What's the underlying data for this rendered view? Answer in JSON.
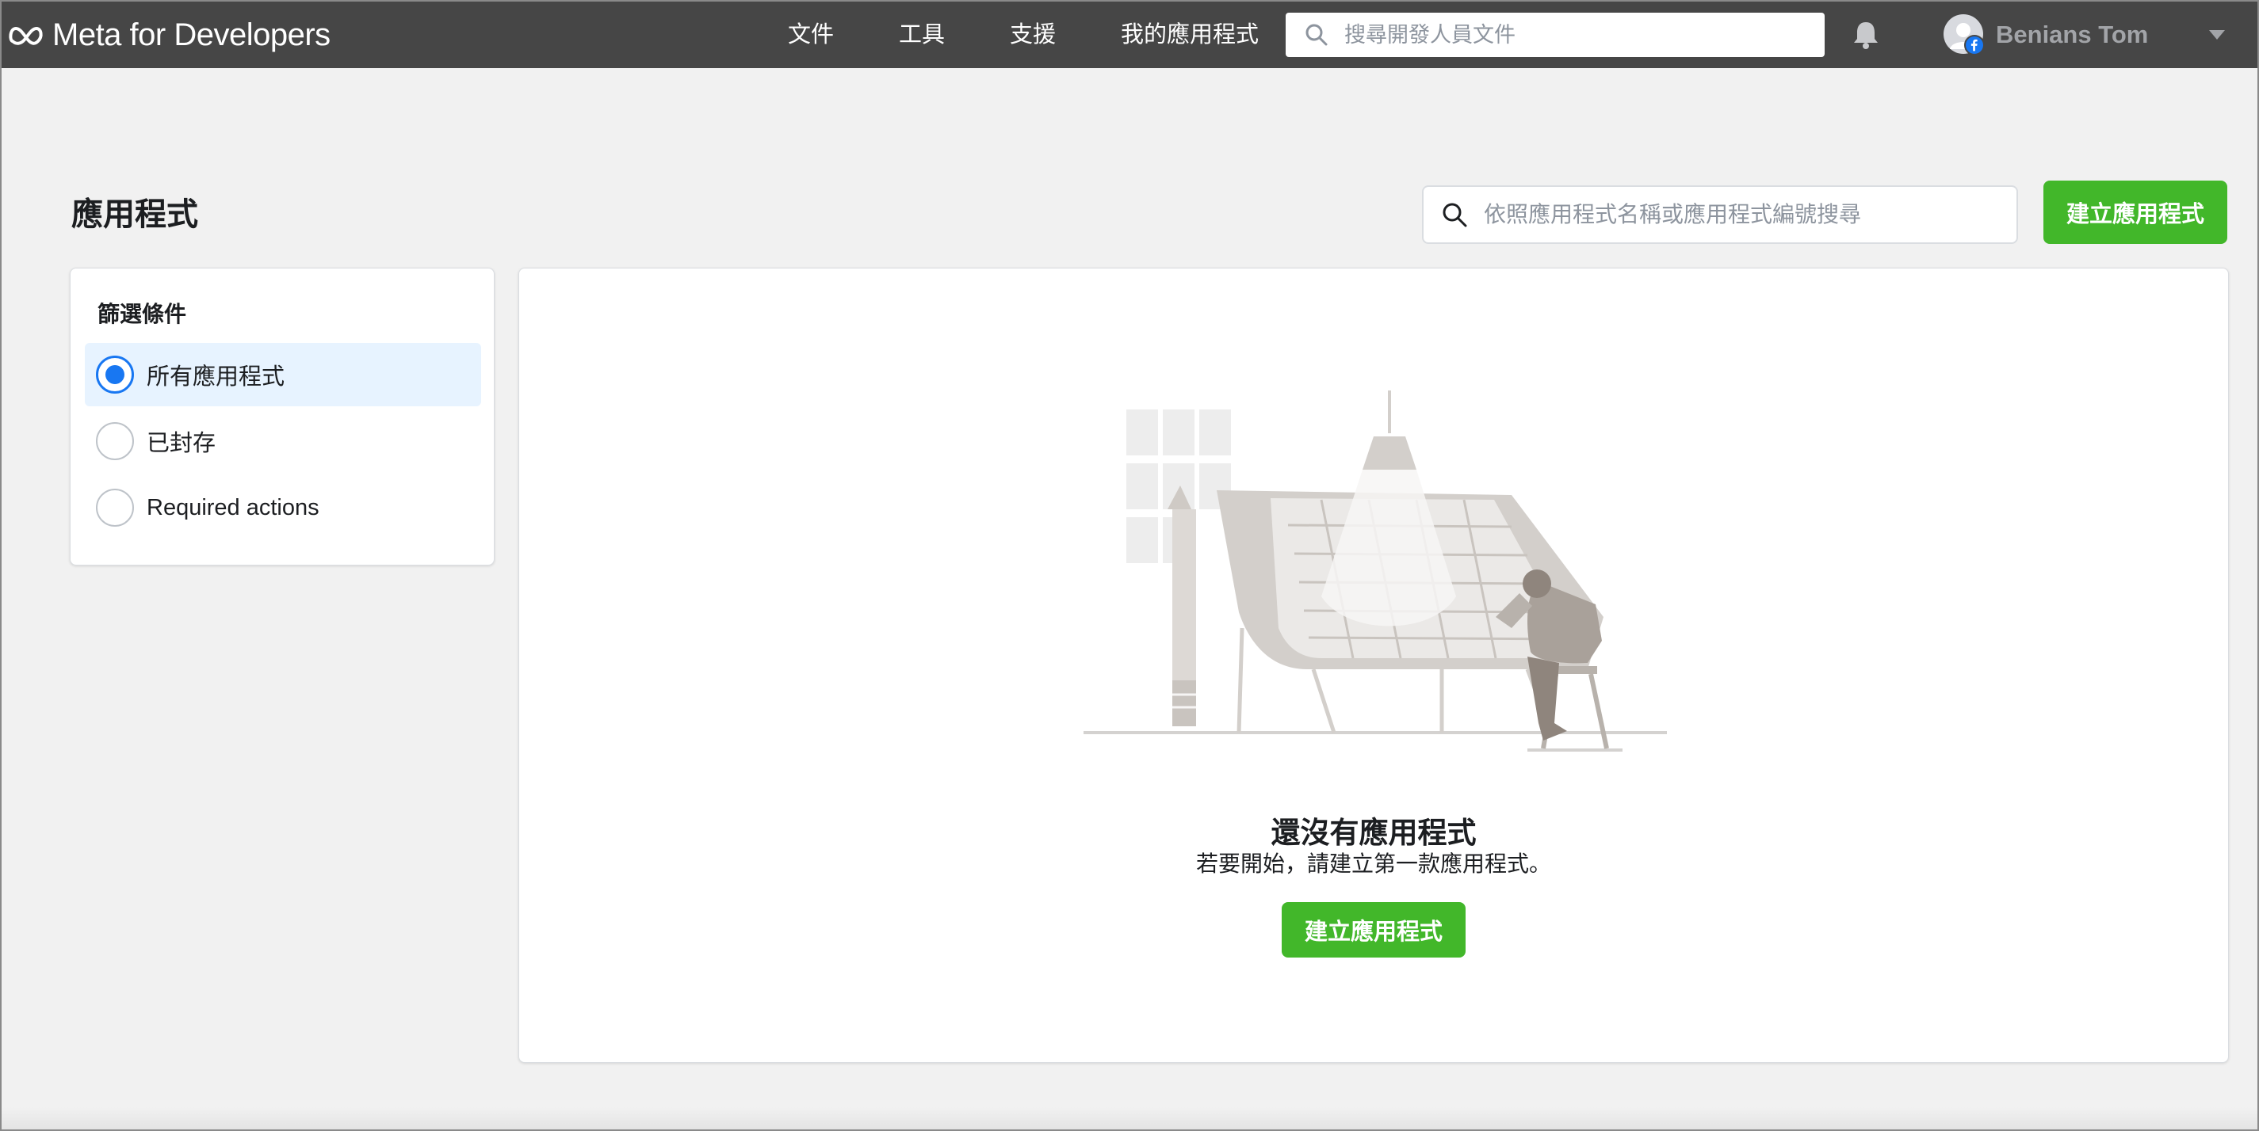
{
  "brand": {
    "name": "Meta for Developers"
  },
  "nav": {
    "docs": "文件",
    "tools": "工具",
    "support": "支援",
    "my_apps": "我的應用程式"
  },
  "top_search": {
    "placeholder": "搜尋開發人員文件"
  },
  "user": {
    "name": "Benians Tom"
  },
  "page": {
    "title": "應用程式",
    "search_placeholder": "依照應用程式名稱或應用程式編號搜尋",
    "create_button": "建立應用程式"
  },
  "filters": {
    "title": "篩選條件",
    "options": [
      {
        "label": "所有應用程式",
        "selected": true
      },
      {
        "label": "已封存",
        "selected": false
      },
      {
        "label": "Required actions",
        "selected": false
      }
    ]
  },
  "empty_state": {
    "title": "還沒有應用程式",
    "subtitle": "若要開始，請建立第一款應用程式。",
    "button": "建立應用程式"
  },
  "colors": {
    "topbar": "#464646",
    "accent_green": "#42b72a",
    "radio_blue": "#1877f2",
    "selected_bg": "#e7f3ff",
    "page_bg": "#f1f1f1"
  }
}
